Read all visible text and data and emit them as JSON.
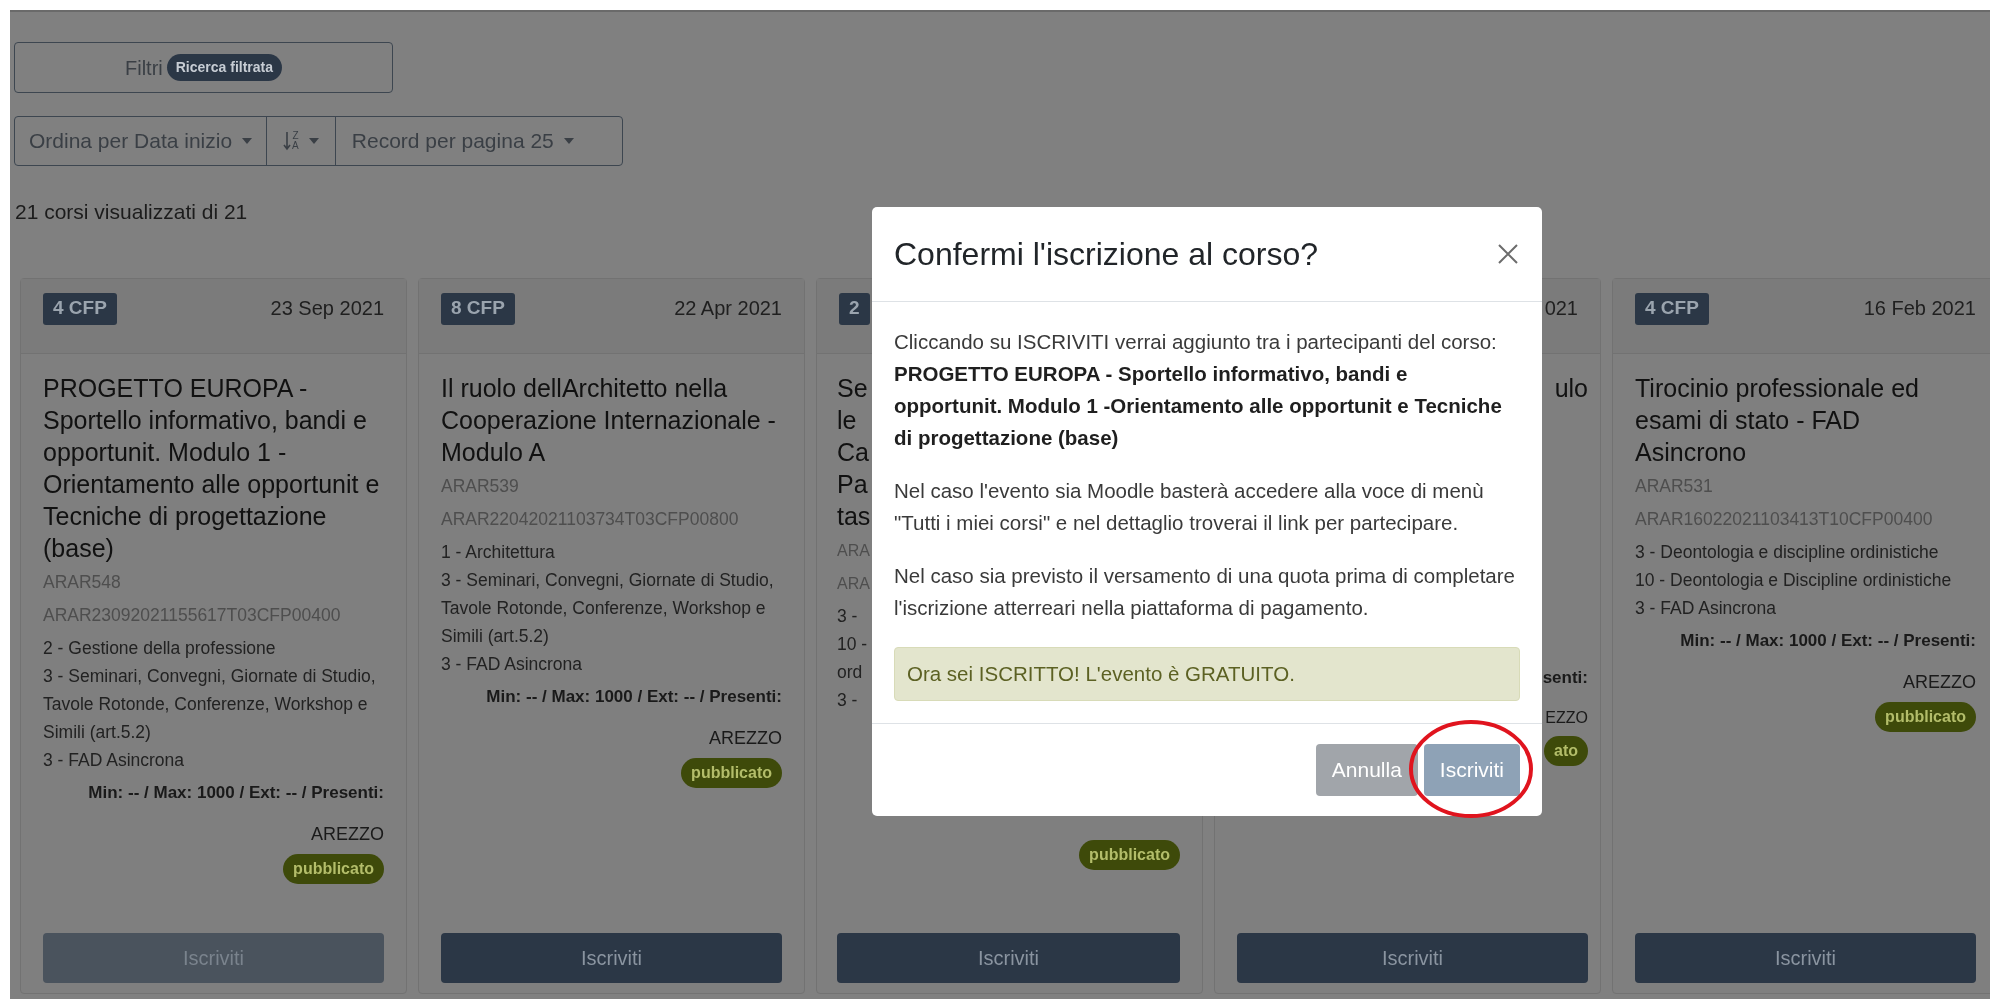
{
  "filters": {
    "label": "Filtri",
    "badge": "Ricerca filtrata"
  },
  "sort_toolbar": {
    "sort_by": "Ordina per Data inizio",
    "direction_top": "Z",
    "direction_bottom": "A",
    "per_page": "Record per pagina 25"
  },
  "results_count": "21 corsi visualizzati di 21",
  "courses": [
    {
      "kind": "full",
      "credits": "4 CFP",
      "date": "23 Sep 2021",
      "title": "PROGETTO EUROPA - Sportello informativo, bandi e opportunit. Modulo 1 -Orientamento alle opportunit e Tecniche di progettazione (base)",
      "code": "ARAR548",
      "event_id": "ARAR23092021155617T03CFP00400",
      "categories": [
        "2 - Gestione della professione",
        "3 - Seminari, Convegni, Giornate di Studio, Tavole Rotonde, Conferenze, Workshop e Simili (art.5.2)",
        "3 - FAD Asincrona"
      ],
      "capacity": "Min: -- / Max: 1000 / Ext: -- / Presenti:",
      "location": "AREZZO",
      "status": "pubblicato",
      "button": {
        "label": "Iscriviti",
        "disabled": true
      }
    },
    {
      "kind": "full",
      "credits": "8 CFP",
      "date": "22 Apr 2021",
      "title": "Il ruolo dellArchitetto nella Cooperazione Internazionale - Modulo A",
      "code": "ARAR539",
      "event_id": "ARAR22042021103734T03CFP00800",
      "categories": [
        "1 - Architettura",
        "3 - Seminari, Convegni, Giornate di Studio, Tavole Rotonde, Conferenze, Workshop e Simili (art.5.2)",
        "3 - FAD Asincrona"
      ],
      "capacity": "Min: -- / Max: 1000 / Ext: -- / Presenti:",
      "location": "AREZZO",
      "status": "pubblicato",
      "button": {
        "label": "Iscriviti",
        "disabled": false
      }
    },
    {
      "kind": "cut_right",
      "credits": "2",
      "title_lines": [
        "Se",
        "le",
        "Ca",
        "Pa",
        "tas"
      ],
      "code": "ARA",
      "event_id": "ARA",
      "categories": [
        "3 -",
        "10 -",
        "ord",
        "3 -"
      ],
      "status": "pubblicato",
      "button": {
        "label": "Iscriviti",
        "disabled": false
      }
    },
    {
      "kind": "cut_left",
      "date": "021",
      "title_lines": [
        "ulo"
      ],
      "capacity": "senti:",
      "location": "EZZO",
      "status": "ato",
      "button": {
        "label": "Iscriviti",
        "disabled": false
      }
    },
    {
      "kind": "full",
      "credits": "4 CFP",
      "date": "16 Feb 2021",
      "title": "Tirocinio professionale ed esami di stato - FAD Asincrono",
      "code": "ARAR531",
      "event_id": "ARAR16022021103413T10CFP00400",
      "categories": [
        "3 - Deontologia e discipline ordinistiche",
        "10 - Deontologia e Discipline ordinistiche",
        "3 - FAD Asincrona"
      ],
      "capacity": "Min: -- / Max: 1000 / Ext: -- / Presenti:",
      "location": "AREZZO",
      "status": "pubblicato",
      "button": {
        "label": "Iscriviti",
        "disabled": false
      }
    }
  ],
  "modal": {
    "title": "Confermi l'iscrizione al corso?",
    "intro": "Cliccando su ISCRIVITI verrai aggiunto tra i partecipanti del corso:",
    "course_title": "PROGETTO EUROPA - Sportello informativo, bandi e opportunit. Modulo 1 -Orientamento alle opportunit e Tecniche di progettazione (base)",
    "paragraphs": [
      "Nel caso l'evento sia Moodle basterà accedere alla voce di menù \"Tutti i miei corsi\" e nel dettaglio troverai il link per partecipare.",
      "Nel caso sia previsto il versamento di una quota prima di completare l'iscrizione atterreari nella piattaforma di pagamento."
    ],
    "alert": "Ora sei ISCRITTO! L'evento è GRATUITO.",
    "buttons": [
      {
        "label": "Annulla",
        "kind": "secondary",
        "highlighted": false
      },
      {
        "label": "Iscriviti",
        "kind": "primary",
        "highlighted": true
      }
    ]
  }
}
